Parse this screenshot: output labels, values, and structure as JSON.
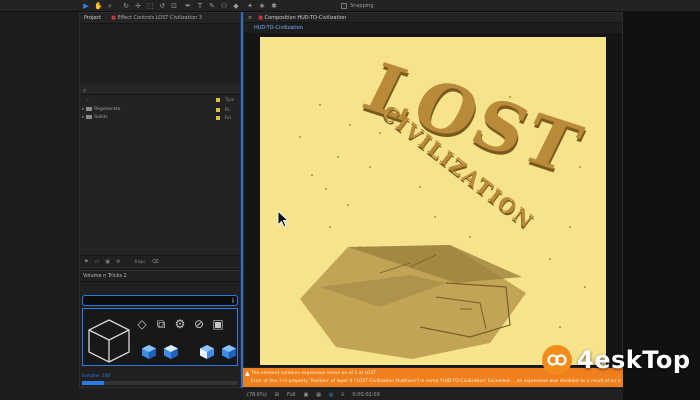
{
  "toolbar": {
    "snapping_label": "Snapping",
    "tools": [
      "▶",
      "✋",
      "🔍",
      "↻",
      "⛶",
      "⬚",
      "✦",
      "T",
      "✎",
      "⌖",
      "◆",
      "✚",
      "★"
    ]
  },
  "project_panel": {
    "tab_project": "Project",
    "tab_effect": "Effect Controls LOST Civilization 3",
    "search_icon": "search-icon",
    "columns": {
      "type": "Type"
    },
    "items": [
      {
        "name": "Regenerate",
        "type": "Fo"
      },
      {
        "name": "Solids",
        "type": "Fol"
      }
    ],
    "footer_bpc": "8 bpc"
  },
  "plugin_panel": {
    "title": "Volume n Tricks 2",
    "info_icon": "i",
    "status": "Installer 100"
  },
  "composition": {
    "tab_title": "Composition HUD-TO-Civilization",
    "sub_tab": "HUD-TO-Civilization",
    "word_lost": "LOST",
    "word_civ": "CIVILIZATION"
  },
  "errors": {
    "line1": "The element contains expression errors  on of 1  at LOST",
    "line2": "Error at line 3 in property 'Position' of layer 4 ('LOST Civilization Outliners') in comp 'HUD-TO-Civilization'  Exceeded  ... an expression was disabled as a result of an e"
  },
  "comp_footer": {
    "zoom": "(78.6%)",
    "resolution": "Full",
    "timecode": "0:00:02:09"
  },
  "watermark": {
    "text": "4eskTop",
    "brand_color": "#f28c1b"
  }
}
